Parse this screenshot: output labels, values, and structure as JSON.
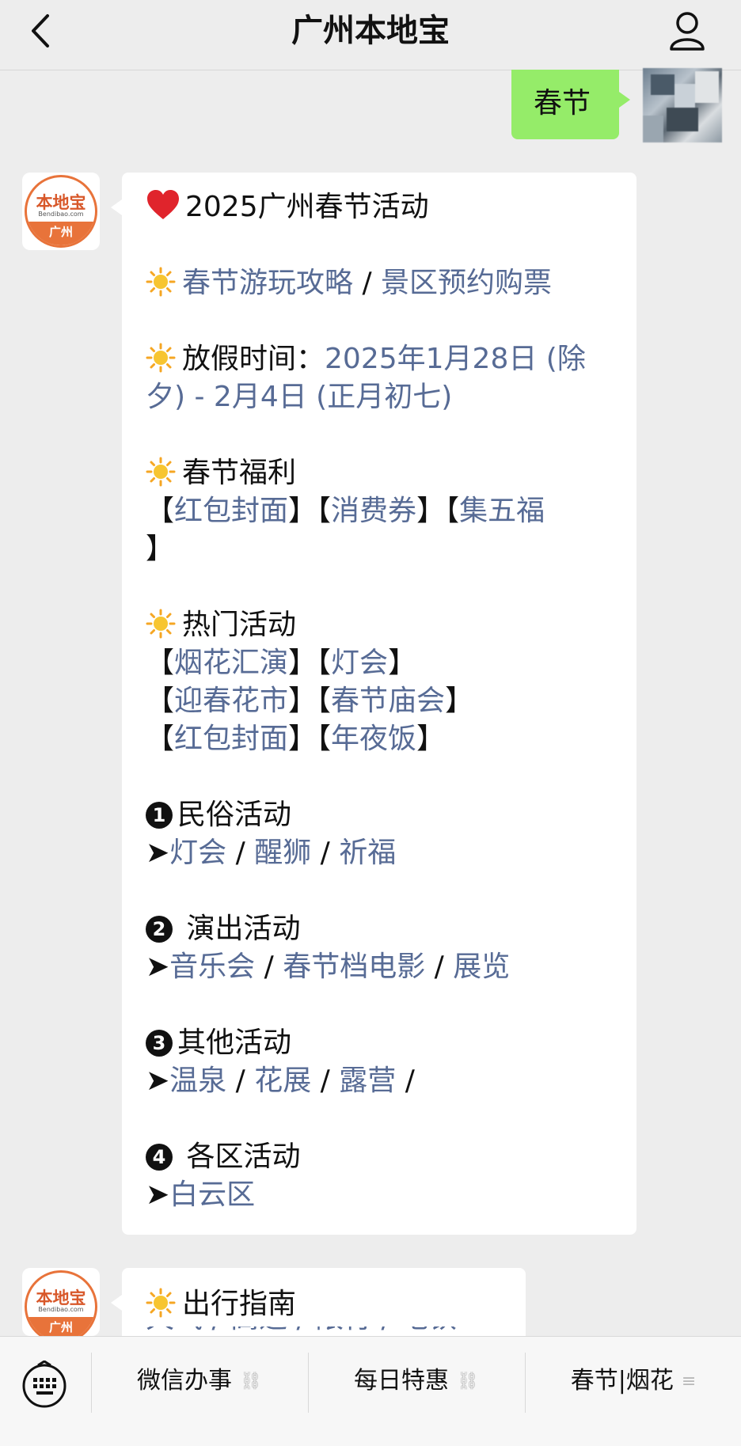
{
  "header": {
    "title": "广州本地宝"
  },
  "user_message": {
    "text": "春节"
  },
  "bot_avatar": {
    "logo_text": "本地宝",
    "logo_sub": "Bendibao.com",
    "city": "广州"
  },
  "message": {
    "title": "2025广州春节活动",
    "guide_link1": "春节游玩攻略",
    "guide_sep": " / ",
    "guide_link2": "景区预约购票",
    "holiday_label": "放假时间：",
    "holiday_value_1": "2025年1月28日 (除",
    "holiday_value_2": "夕) - 2月4日 (正月初七)",
    "benefits_title": "春节福利",
    "benefits": [
      "红包封面",
      "消费券",
      "集五福"
    ],
    "hot_title": "热门活动",
    "hot": [
      [
        "烟花汇演",
        "灯会"
      ],
      [
        "迎春花市",
        "春节庙会"
      ],
      [
        "红包封面",
        "年夜饭"
      ]
    ],
    "sections": [
      {
        "num": "1",
        "title": "民俗活动",
        "links": [
          "灯会",
          "醒狮",
          "祈福"
        ]
      },
      {
        "num": "2",
        "title": "演出活动",
        "links": [
          "音乐会",
          "春节档电影",
          "展览"
        ]
      },
      {
        "num": "3",
        "title": "其他活动",
        "links": [
          "温泉",
          "花展",
          "露营"
        ]
      },
      {
        "num": "4",
        "title": "各区活动",
        "links": [
          "白云区"
        ]
      }
    ],
    "arrow": "➤"
  },
  "message2": {
    "title": "出行指南",
    "partial": "天气 / 高速 / 限行 / 地铁"
  },
  "menu": {
    "items": [
      "微信办事",
      "每日特惠",
      "春节|烟花"
    ]
  },
  "colors": {
    "link": "#576b95",
    "bubble_me": "#95ec69",
    "accent": "#e8733a"
  }
}
